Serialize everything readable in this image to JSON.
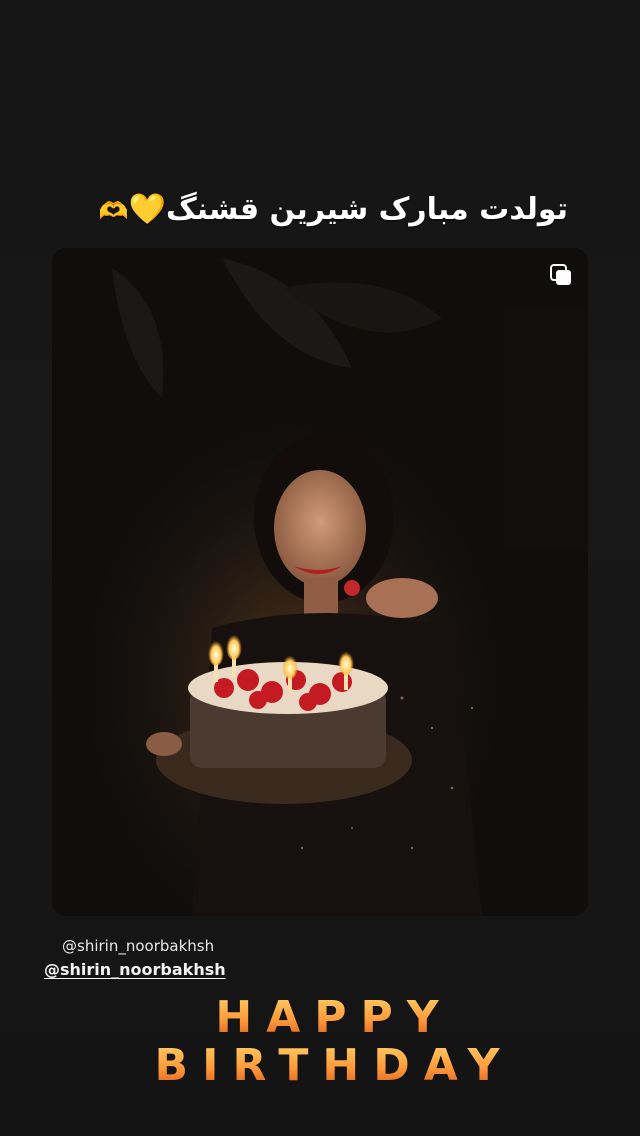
{
  "story": {
    "caption": "تولدت مبارک شیرین قشنگ",
    "caption_emoji_heart": "💛",
    "caption_emoji_hands": "🫶",
    "mention_text": "@shirin_noorbakhsh",
    "mention_sticker": "@shirin_noorbakhsh",
    "birthday_line1": "HAPPY",
    "birthday_line2": "BIRTHDAY",
    "photo": {
      "description_icon": "multiple-photos-icon"
    }
  }
}
